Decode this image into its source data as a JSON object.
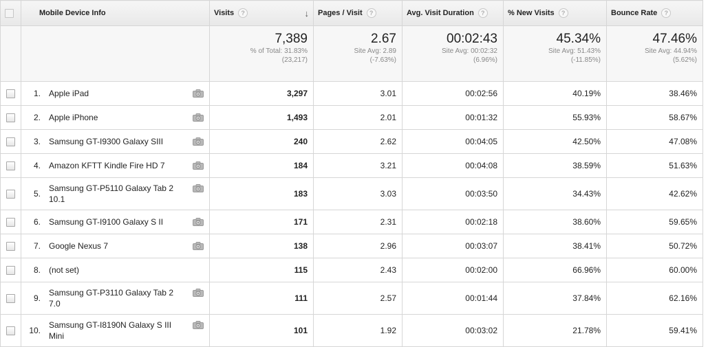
{
  "columns": {
    "device": "Mobile Device Info",
    "visits": "Visits",
    "pages_per_visit": "Pages / Visit",
    "avg_visit_duration": "Avg. Visit Duration",
    "new_visits": "% New Visits",
    "bounce_rate": "Bounce Rate",
    "help_glyph": "?",
    "sort_glyph": "↓"
  },
  "totals": {
    "visits": {
      "value": "7,389",
      "line1": "% of Total: 31.83%",
      "line2": "(23,217)"
    },
    "pages_per_visit": {
      "value": "2.67",
      "line1": "Site Avg: 2.89",
      "line2": "(-7.63%)"
    },
    "avg_visit_duration": {
      "value": "00:02:43",
      "line1": "Site Avg: 00:02:32",
      "line2": "(6.96%)"
    },
    "new_visits": {
      "value": "45.34%",
      "line1": "Site Avg: 51.43%",
      "line2": "(-11.85%)"
    },
    "bounce_rate": {
      "value": "47.46%",
      "line1": "Site Avg: 44.94%",
      "line2": "(5.62%)"
    }
  },
  "rows": [
    {
      "index": "1.",
      "device": "Apple iPad",
      "visits": "3,297",
      "pages": "3.01",
      "duration": "00:02:56",
      "new": "40.19%",
      "bounce": "38.46%",
      "camera": true
    },
    {
      "index": "2.",
      "device": "Apple iPhone",
      "visits": "1,493",
      "pages": "2.01",
      "duration": "00:01:32",
      "new": "55.93%",
      "bounce": "58.67%",
      "camera": true
    },
    {
      "index": "3.",
      "device": "Samsung GT-I9300 Galaxy SIII",
      "visits": "240",
      "pages": "2.62",
      "duration": "00:04:05",
      "new": "42.50%",
      "bounce": "47.08%",
      "camera": true
    },
    {
      "index": "4.",
      "device": "Amazon KFTT Kindle Fire HD 7",
      "visits": "184",
      "pages": "3.21",
      "duration": "00:04:08",
      "new": "38.59%",
      "bounce": "51.63%",
      "camera": true
    },
    {
      "index": "5.",
      "device": "Samsung GT-P5110 Galaxy Tab 2 10.1",
      "visits": "183",
      "pages": "3.03",
      "duration": "00:03:50",
      "new": "34.43%",
      "bounce": "42.62%",
      "camera": true
    },
    {
      "index": "6.",
      "device": "Samsung GT-I9100 Galaxy S II",
      "visits": "171",
      "pages": "2.31",
      "duration": "00:02:18",
      "new": "38.60%",
      "bounce": "59.65%",
      "camera": true
    },
    {
      "index": "7.",
      "device": "Google Nexus 7",
      "visits": "138",
      "pages": "2.96",
      "duration": "00:03:07",
      "new": "38.41%",
      "bounce": "50.72%",
      "camera": true
    },
    {
      "index": "8.",
      "device": "(not set)",
      "visits": "115",
      "pages": "2.43",
      "duration": "00:02:00",
      "new": "66.96%",
      "bounce": "60.00%",
      "camera": false
    },
    {
      "index": "9.",
      "device": "Samsung GT-P3110 Galaxy Tab 2 7.0",
      "visits": "111",
      "pages": "2.57",
      "duration": "00:01:44",
      "new": "37.84%",
      "bounce": "62.16%",
      "camera": true
    },
    {
      "index": "10.",
      "device": "Samsung GT-I8190N Galaxy S III Mini",
      "visits": "101",
      "pages": "1.92",
      "duration": "00:03:02",
      "new": "21.78%",
      "bounce": "59.41%",
      "camera": true
    }
  ]
}
